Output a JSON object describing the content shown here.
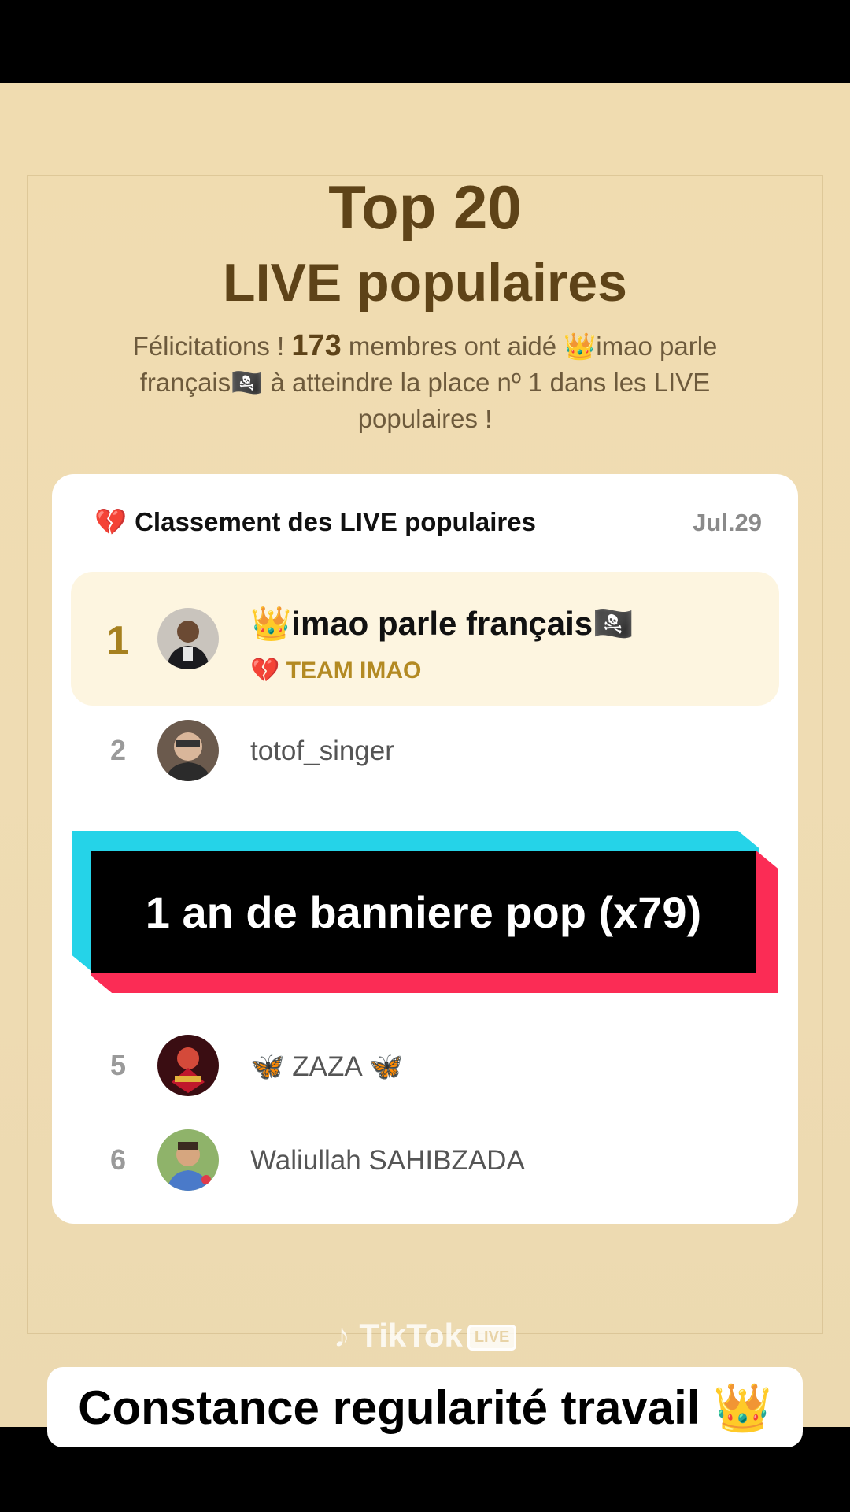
{
  "header": {
    "title_line1": "Top 20",
    "title_line2": "LIVE populaires",
    "congrats_prefix": "Félicitations ! ",
    "congrats_count": "173",
    "congrats_suffix": " membres ont aidé 👑imao parle français🏴‍☠️ à atteindre la place nº 1 dans les LIVE populaires !"
  },
  "card": {
    "heart": "💔",
    "title": "Classement des LIVE populaires",
    "date": "Jul.29"
  },
  "ranking": [
    {
      "rank": "1",
      "name": "👑imao parle français🏴‍☠️",
      "team": "💔 TEAM IMAO"
    },
    {
      "rank": "2",
      "name": "totof_singer"
    },
    {
      "rank": "5",
      "name": "🦋 ZAZA 🦋"
    },
    {
      "rank": "6",
      "name": "Waliullah SAHIBZADA"
    }
  ],
  "banner": {
    "text": "1 an de banniere pop (x79)"
  },
  "watermark": {
    "brand": "TikTok",
    "badge": "LIVE"
  },
  "caption": {
    "text": "Constance regularité travail 👑"
  },
  "colors": {
    "accent_gold": "#a6801f",
    "title_brown": "#5e4318",
    "cyan": "#25d3e8",
    "red": "#fb2c55"
  }
}
